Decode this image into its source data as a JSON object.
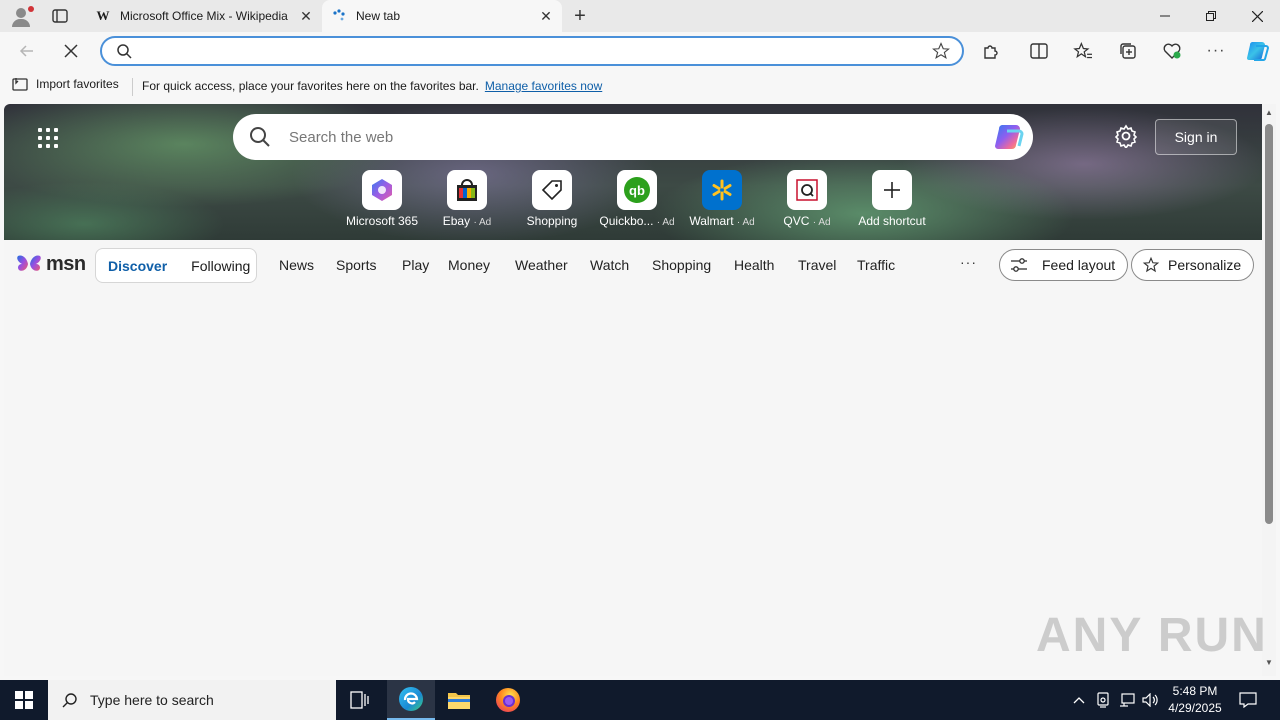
{
  "browser": {
    "tabs": [
      {
        "title": "Microsoft Office Mix - Wikipedia",
        "favicon": "wikipedia-icon",
        "favicon_text": "W",
        "active": false
      },
      {
        "title": "New tab",
        "favicon": "loading-dots-icon",
        "active": true
      }
    ],
    "omnibox": {
      "value": "",
      "placeholder": ""
    },
    "accent": "#4a90d9"
  },
  "favorites_bar": {
    "import_label": "Import favorites",
    "message": "For quick access, place your favorites here on the favorites bar.",
    "manage_link": "Manage favorites now"
  },
  "newtab": {
    "search_placeholder": "Search the web",
    "signin_label": "Sign in",
    "shortcuts": [
      {
        "label": "Microsoft 365",
        "ad": "",
        "icon": "m365-icon"
      },
      {
        "label": "Ebay",
        "ad": "· Ad",
        "icon": "ebay-bag-icon"
      },
      {
        "label": "Shopping",
        "ad": "",
        "icon": "price-tag-icon"
      },
      {
        "label": "Quickbo...",
        "ad": "· Ad",
        "icon": "quickbooks-icon"
      },
      {
        "label": "Walmart",
        "ad": "· Ad",
        "icon": "walmart-spark-icon"
      },
      {
        "label": "QVC",
        "ad": "· Ad",
        "icon": "qvc-icon"
      },
      {
        "label": "Add shortcut",
        "ad": "",
        "icon": "plus-icon"
      }
    ]
  },
  "msn": {
    "logo_text": "msn",
    "pills": [
      "Discover",
      "Following"
    ],
    "nav": [
      "News",
      "Sports",
      "Play",
      "Money",
      "Weather",
      "Watch",
      "Shopping",
      "Health",
      "Travel",
      "Traffic"
    ],
    "more": "···",
    "feed_layout": "Feed layout",
    "personalize": "Personalize"
  },
  "watermark": "ANY RUN",
  "taskbar": {
    "search_placeholder": "Type here to search",
    "time": "5:48 PM",
    "date": "4/29/2025"
  }
}
